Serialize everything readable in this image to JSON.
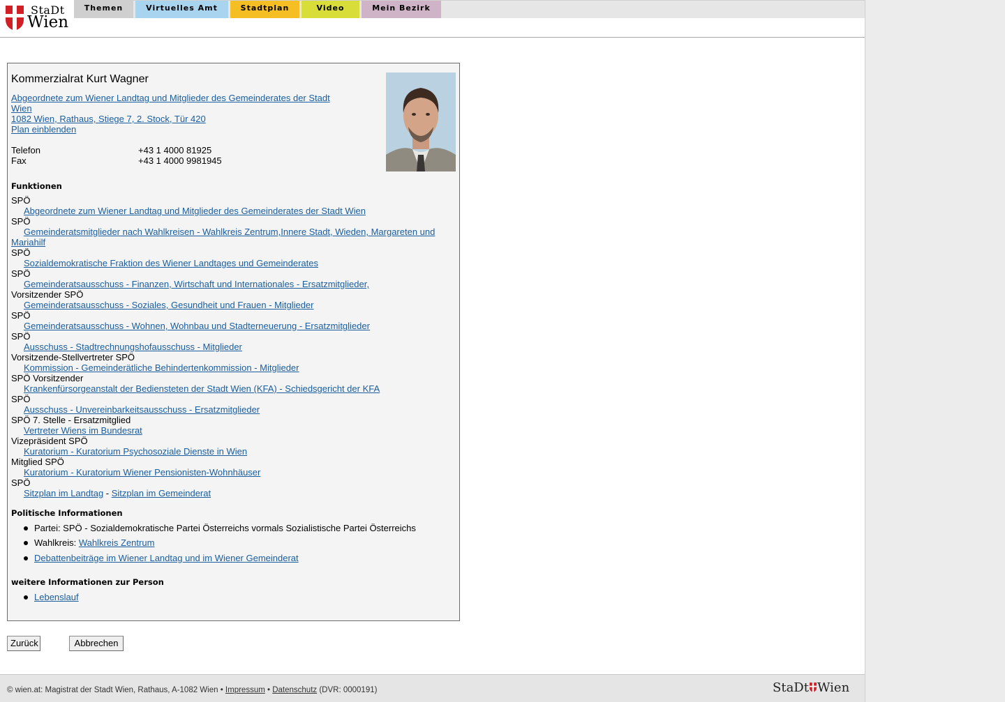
{
  "logo": {
    "line1": "StaDt",
    "line2": "Wien"
  },
  "nav": [
    {
      "label": "Themen",
      "color": "#cfcfcf"
    },
    {
      "label": "Virtuelles Amt",
      "color": "#a9d4f0"
    },
    {
      "label": "Stadtplan",
      "color": "#f5bf23"
    },
    {
      "label": "Video",
      "color": "#d9dd3a"
    },
    {
      "label": "Mein Bezirk",
      "color": "#cfb3c6"
    }
  ],
  "person": {
    "name": "Kommerzialrat Kurt Wagner",
    "org_line1": "Abgeordnete zum Wiener Landtag und Mitglieder des Gemeinderates der Stadt",
    "org_line2": "Wien ",
    "address": "1082 Wien, Rathaus, Stiege 7, 2. Stock, Tür 420",
    "plan_link": "Plan einblenden",
    "phone_label": "Telefon",
    "phone": "+43 1 4000 81925",
    "fax_label": "Fax",
    "fax": "+43 1 4000 9981945"
  },
  "functions_heading": "Funktionen",
  "functions": [
    {
      "role": "SPÖ",
      "link": "Abgeordnete zum Wiener Landtag und Mitglieder des Gemeinderates der Stadt Wien"
    },
    {
      "role": "SPÖ",
      "link": "Gemeinderatsmitglieder nach Wahlkreisen - Wahlkreis Zentrum,Innere Stadt, Wieden, Margareten und Mariahilf"
    },
    {
      "role": "SPÖ",
      "link": "Sozialdemokratische Fraktion des Wiener Landtages und Gemeinderates"
    },
    {
      "role": "SPÖ",
      "link": "Gemeinderatsausschuss - Finanzen, Wirtschaft und Internationales - Ersatzmitglieder,"
    },
    {
      "role": "Vorsitzender SPÖ",
      "link": "Gemeinderatsausschuss - Soziales, Gesundheit und Frauen - Mitglieder"
    },
    {
      "role": "SPÖ",
      "link": "Gemeinderatsausschuss - Wohnen, Wohnbau und Stadterneuerung - Ersatzmitglieder"
    },
    {
      "role": "SPÖ",
      "link": "Ausschuss - Stadtrechnungshofausschuss - Mitglieder"
    },
    {
      "role": "Vorsitzende-Stellvertreter SPÖ",
      "link": "Kommission - Gemeinderätliche Behindertenkommission - Mitglieder"
    },
    {
      "role": "SPÖ Vorsitzender",
      "link": "Krankenfürsorgeanstalt der Bediensteten der Stadt Wien (KFA) - Schiedsgericht der KFA"
    },
    {
      "role": "SPÖ",
      "link": "Ausschuss - Unvereinbarkeitsausschuss - Ersatzmitglieder"
    },
    {
      "role": "SPÖ 7. Stelle - Ersatzmitglied",
      "link": "Vertreter Wiens im Bundesrat"
    },
    {
      "role": "Vizepräsident SPÖ",
      "link": "Kuratorium - Kuratorium Psychosoziale Dienste in Wien"
    },
    {
      "role": "Mitglied SPÖ",
      "link": "Kuratorium - Kuratorium Wiener Pensionisten-Wohnhäuser"
    },
    {
      "role": "SPÖ",
      "link": null
    }
  ],
  "sitzplan": {
    "landtag": "Sitzplan im Landtag",
    "sep": " - ",
    "gemeinderat": "Sitzplan im Gemeinderat"
  },
  "political_heading": "Politische Informationen",
  "political": {
    "party": "Partei: SPÖ - Sozialdemokratische Partei Österreichs vormals Sozialistische Partei Österreichs",
    "wahlkreis_label": "Wahlkreis: ",
    "wahlkreis_link": "Wahlkreis Zentrum",
    "debatten": "Debattenbeiträge im Wiener Landtag und im Wiener Gemeinderat"
  },
  "more_heading": "weitere Informationen zur Person",
  "more": {
    "lebenslauf": "Lebenslauf"
  },
  "buttons": {
    "back": "Zurück",
    "cancel": "Abbrechen"
  },
  "footer": {
    "prefix": "© wien.at: Magistrat der Stadt Wien, Rathaus, A-1082 Wien • ",
    "impressum": "Impressum",
    "bullet": " • ",
    "datenschutz": "Datenschutz",
    "dvr": " (DVR: 0000191)",
    "logo_left": "StaDt",
    "logo_right": "Wien"
  }
}
